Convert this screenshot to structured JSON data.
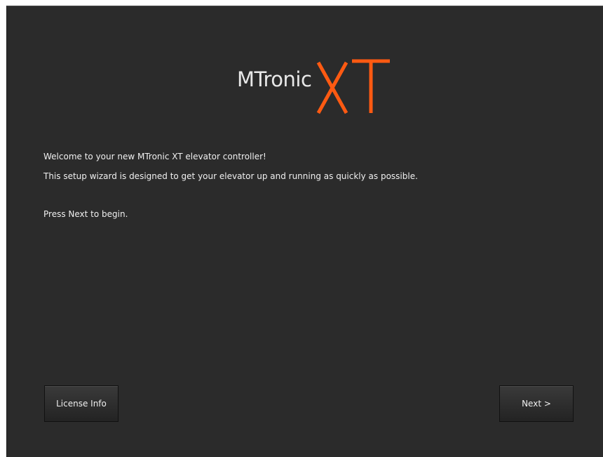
{
  "logo": {
    "text": "MTronic",
    "mark": "XT",
    "mark_color": "#ff5a12"
  },
  "wizard": {
    "welcome": "Welcome to your new MTronic XT elevator controller!",
    "description": "This setup wizard is designed to get your elevator up and running as quickly as possible.",
    "instruction": "Press Next to begin."
  },
  "buttons": {
    "license": "License Info",
    "next": "Next >"
  },
  "colors": {
    "background": "#2b2b2b",
    "text": "#f0f0f0",
    "accent": "#ff5a12"
  }
}
